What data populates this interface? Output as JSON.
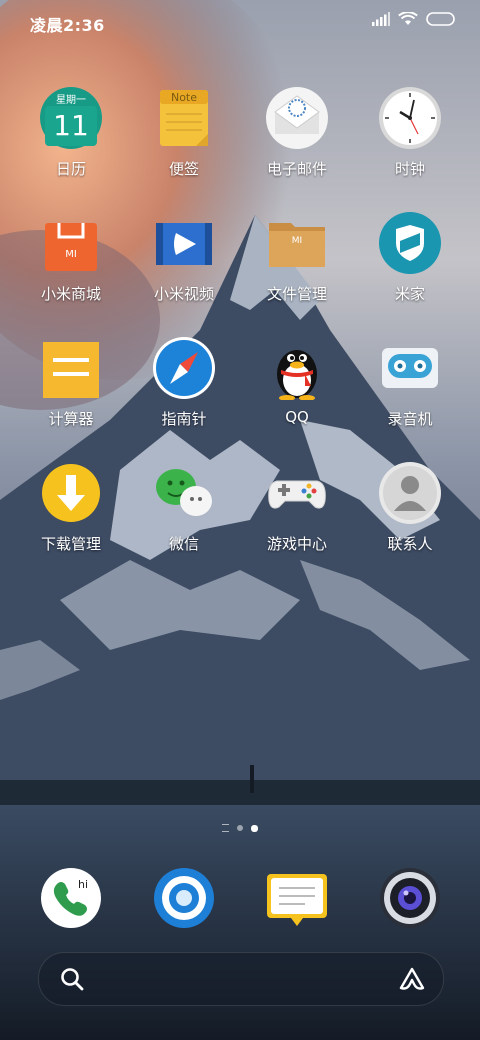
{
  "status_bar": {
    "time": "凌晨2:36"
  },
  "apps": [
    {
      "label": "日历",
      "icon": "calendar-icon",
      "weekday": "星期一",
      "day": "11"
    },
    {
      "label": "便签",
      "icon": "notes-icon",
      "note": "Note"
    },
    {
      "label": "电子邮件",
      "icon": "email-icon"
    },
    {
      "label": "时钟",
      "icon": "clock-icon"
    },
    {
      "label": "小米商城",
      "icon": "mi-store-icon",
      "badge": "MI"
    },
    {
      "label": "小米视频",
      "icon": "mi-video-icon"
    },
    {
      "label": "文件管理",
      "icon": "file-manager-icon",
      "badge": "MI"
    },
    {
      "label": "米家",
      "icon": "mijia-icon"
    },
    {
      "label": "计算器",
      "icon": "calculator-icon"
    },
    {
      "label": "指南针",
      "icon": "compass-icon"
    },
    {
      "label": "QQ",
      "icon": "qq-penguin-icon"
    },
    {
      "label": "录音机",
      "icon": "recorder-icon"
    },
    {
      "label": "下载管理",
      "icon": "download-icon"
    },
    {
      "label": "微信",
      "icon": "wechat-icon"
    },
    {
      "label": "游戏中心",
      "icon": "gamepad-icon"
    },
    {
      "label": "联系人",
      "icon": "contacts-icon"
    }
  ],
  "dock": [
    {
      "icon": "phone-icon",
      "badge": "hi"
    },
    {
      "icon": "browser-icon"
    },
    {
      "icon": "messages-icon"
    },
    {
      "icon": "camera-icon"
    }
  ],
  "colors": {
    "sky_top": "#b8bcc6",
    "mountain": "#3a4a60",
    "snow": "#c9d2de",
    "water": "#1a2433",
    "calendar_green": "#179b86",
    "notes_yellow": "#f5c23c",
    "mi_orange": "#ef6530",
    "mijia_teal": "#1a96b0",
    "calc_yellow": "#f5b82e",
    "download_yellow": "#f6c21d",
    "wechat_green": "#3cb34a"
  }
}
